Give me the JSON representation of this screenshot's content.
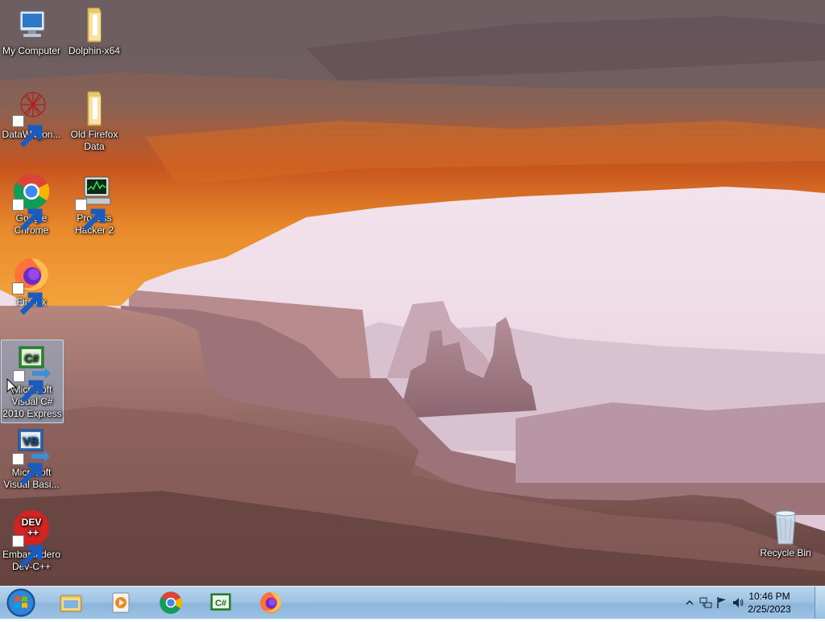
{
  "desktop_icons": [
    {
      "label": "My Computer",
      "icon": "computer-icon"
    },
    {
      "label": "Dolphin-x64",
      "icon": "folder-icon"
    },
    {
      "label": "DataWagon...",
      "icon": "datawagon-icon"
    },
    {
      "label": "Old Firefox Data",
      "icon": "folder-icon"
    },
    {
      "label": "Google Chrome",
      "icon": "chrome-icon"
    },
    {
      "label": "Process Hacker 2",
      "icon": "process-hacker-icon"
    },
    {
      "label": "Firefox",
      "icon": "firefox-icon"
    },
    {
      "label": "Microsoft Visual C# 2010 Express",
      "icon": "visual-csharp-icon",
      "selected": true
    },
    {
      "label": "Microsoft Visual Basi...",
      "icon": "visual-basic-icon"
    },
    {
      "label": "Embarcadero Dev-C++",
      "icon": "devcpp-icon"
    },
    {
      "label": "Recycle Bin",
      "icon": "recycle-bin-icon"
    }
  ],
  "taskbar": {
    "start": "start-orb-icon",
    "pinned": [
      "explorer-icon",
      "media-player-icon",
      "chrome-icon",
      "visual-csharp-icon",
      "firefox-icon"
    ],
    "tray_icons": [
      "show-hidden-icons",
      "network-icon",
      "action-center-flag-icon",
      "volume-icon"
    ],
    "clock": {
      "time": "10:46 PM",
      "date": "2/25/2023"
    }
  },
  "colors": {
    "taskbar": "#9fc4e3",
    "selection": "#8cbee6"
  }
}
